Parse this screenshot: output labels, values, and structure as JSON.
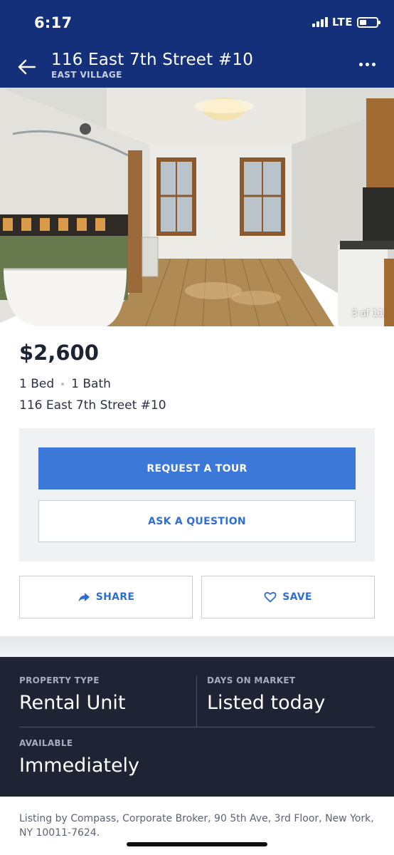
{
  "status_bar": {
    "time": "6:17",
    "network": "LTE",
    "battery_level": 0.4
  },
  "header": {
    "title": "116 East 7th Street #10",
    "subtitle": "EAST VILLAGE",
    "icons": {
      "back": "arrow-left-icon",
      "more": "more-horizontal-icon"
    }
  },
  "photo": {
    "counter": "3 of 11"
  },
  "listing": {
    "price": "$2,600",
    "beds": "1 Bed",
    "baths": "1 Bath",
    "address": "116 East 7th Street #10"
  },
  "actions": {
    "request_tour": "REQUEST A TOUR",
    "ask_question": "ASK A QUESTION",
    "share": "SHARE",
    "save": "SAVE",
    "share_icon": "share-arrow-icon",
    "save_icon": "heart-outline-icon"
  },
  "stats": {
    "property_type_label": "PROPERTY TYPE",
    "property_type_value": "Rental Unit",
    "days_on_market_label": "DAYS ON MARKET",
    "days_on_market_value": "Listed today",
    "available_label": "AVAILABLE",
    "available_value": "Immediately"
  },
  "footer": {
    "note": "Listing by Compass, Corporate Broker, 90 5th Ave, 3rd Floor, New York, NY 10011-7624."
  },
  "colors": {
    "header_bg": "#14307a",
    "primary_button": "#3b78d8",
    "link_blue": "#2f6fd1",
    "stats_bg": "#1e2433"
  }
}
